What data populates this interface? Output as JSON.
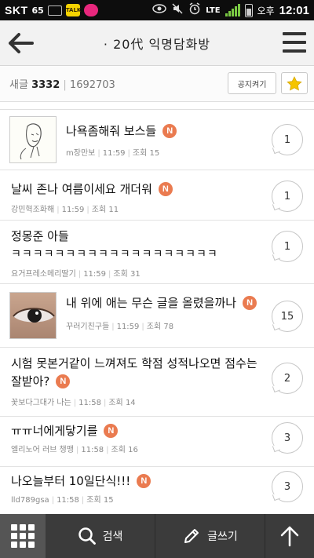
{
  "statusbar": {
    "carrier": "SKT",
    "notif_count": "65",
    "talk_label": "TALK",
    "network": "LTE",
    "ampm": "오후",
    "time": "12:01"
  },
  "header": {
    "title": "· 20代 익명담화방"
  },
  "subbar": {
    "new_posts_label": "새글",
    "new_posts": "3332",
    "total_posts": "1692703",
    "notice_button": "공지켜기"
  },
  "posts": [
    {
      "title": "나욕좀해줘 보스들",
      "author": "m장만보",
      "time": "11:59",
      "views": "조회 15",
      "comments": "1",
      "has_thumb": true
    },
    {
      "title": "날씨 존나 여름이세요 개더워",
      "author": "강민혁조화해",
      "time": "11:59",
      "views": "조회 11",
      "comments": "1"
    },
    {
      "title": "정몽준 아들",
      "title_line2": "ㅋㅋㅋㅋㅋㅋㅋㅋㅋㅋㅋㅋㅋㅋㅋㅋㅋㅋㅋ",
      "author": "요거프레소메리딸기",
      "time": "11:59",
      "views": "조회 31",
      "comments": "1"
    },
    {
      "title": "내 위에 애는 무슨 글을 올렸을까나",
      "author": "꾸러기친구들",
      "time": "11:59",
      "views": "조회 78",
      "comments": "15",
      "has_thumb": true
    },
    {
      "title": "시험 못본거같이 느껴져도 학점 성적나오면 점수는",
      "title_line2": "잘받아?",
      "author": "꽃보다그대가 나는",
      "time": "11:58",
      "views": "조회 14",
      "comments": "2"
    },
    {
      "title": "ㅠㅠ너에게닿기를",
      "author": "엘리노어 러브 챙맹",
      "time": "11:58",
      "views": "조회 16",
      "comments": "3"
    },
    {
      "title": "나오늘부터 10일단식!!!",
      "author": "lld789gsa",
      "time": "11:58",
      "views": "조회 15",
      "comments": "3"
    }
  ],
  "new_badge": "N",
  "bottombar": {
    "search_label": "검색",
    "write_label": "글쓰기"
  },
  "colors": {
    "new_badge": "#ea7b50",
    "bottom_bar": "#3b3b3b",
    "star": "#f5c400"
  }
}
